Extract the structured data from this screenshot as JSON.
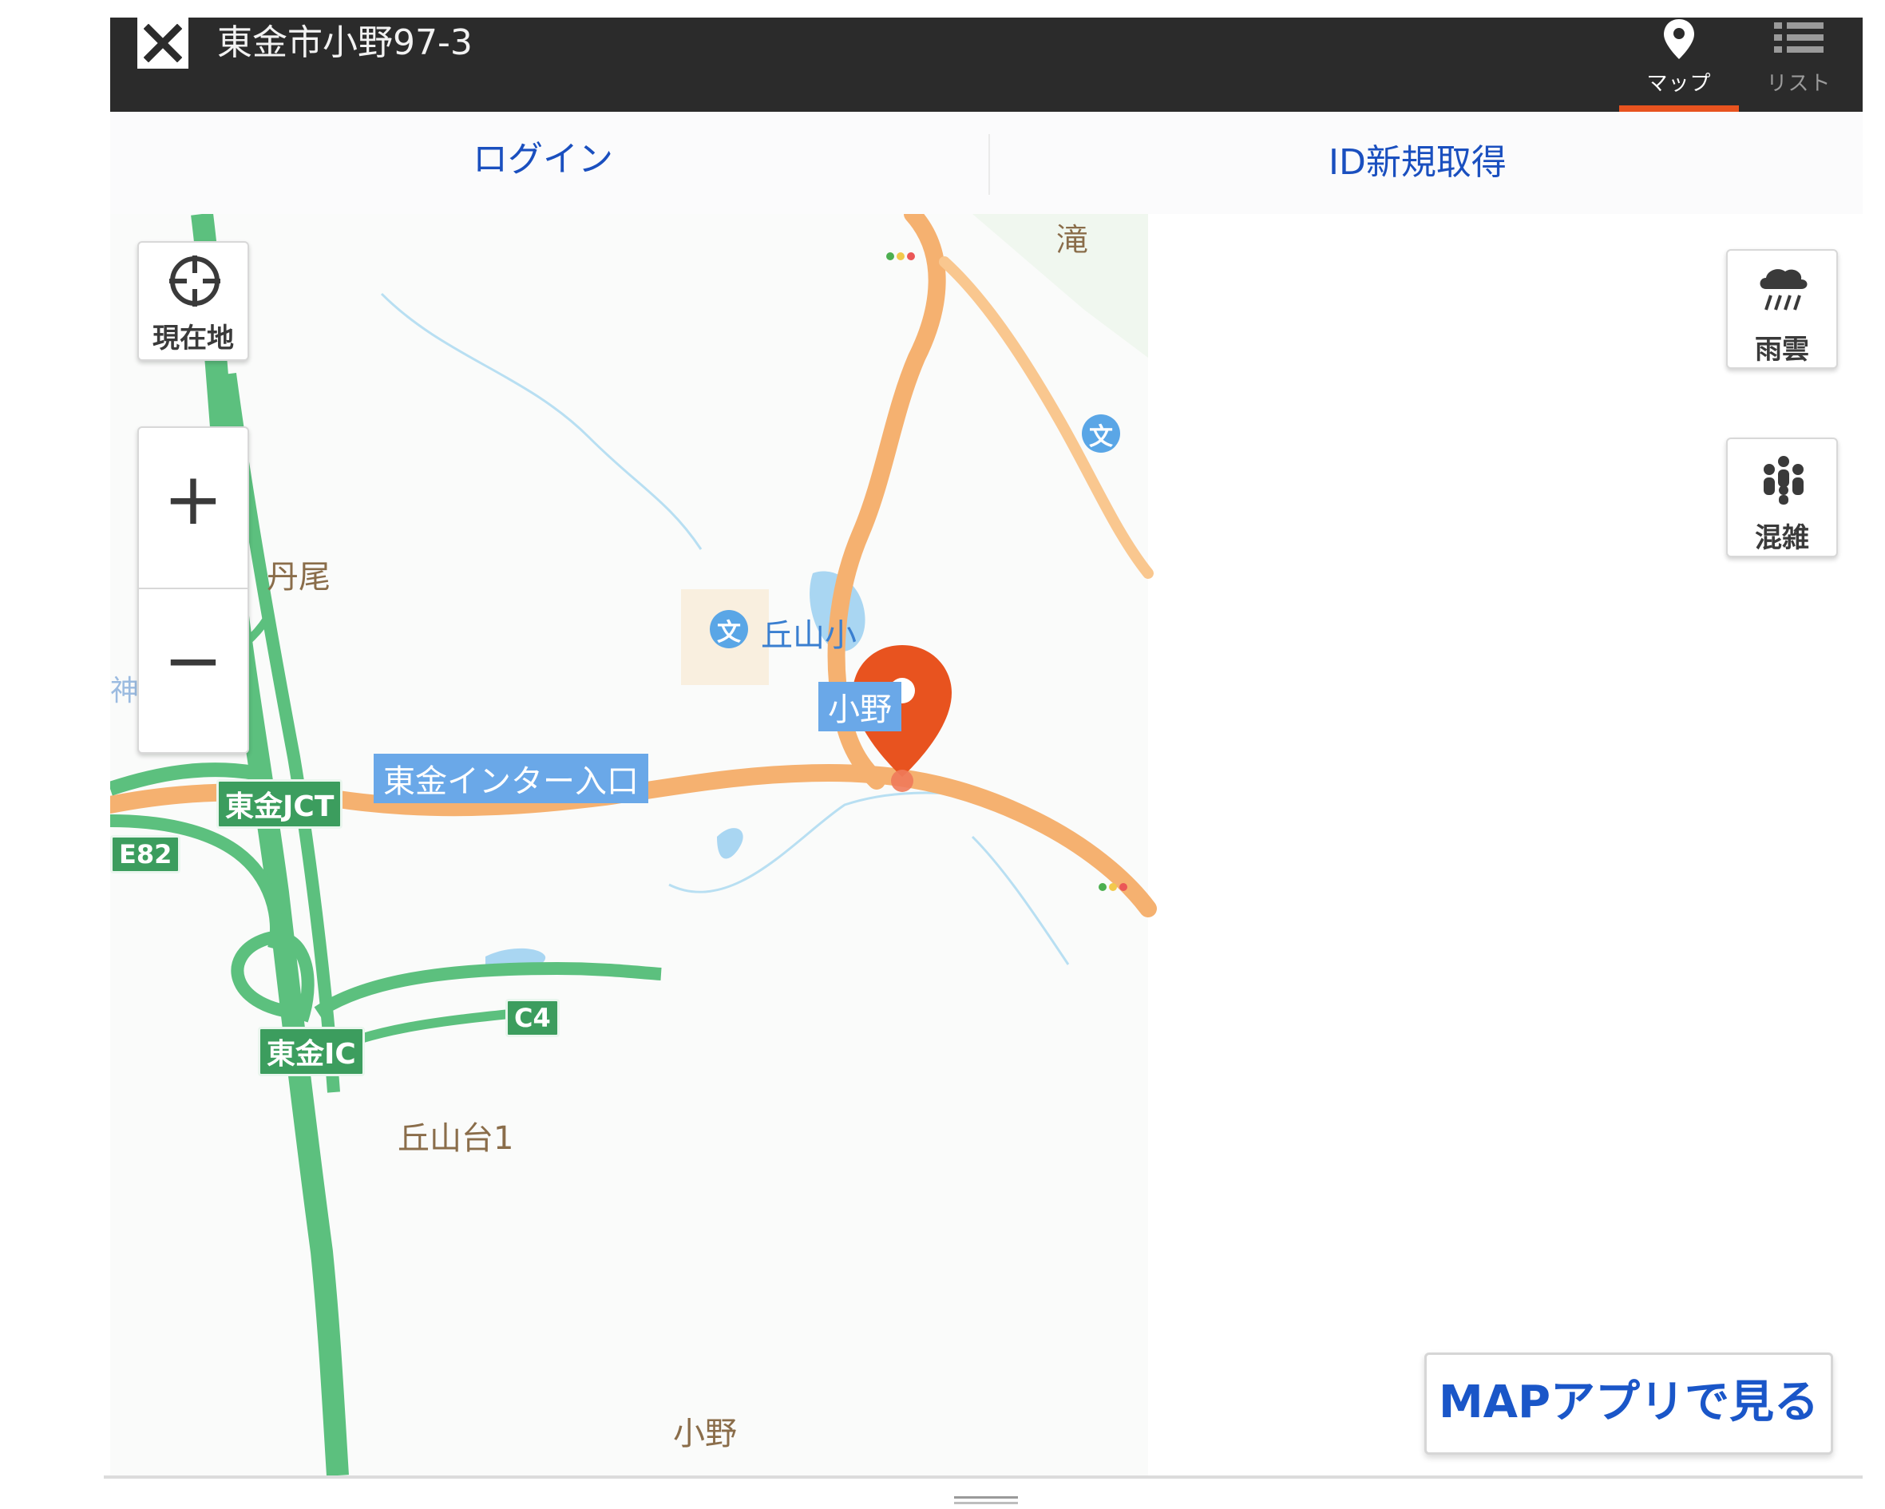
{
  "header": {
    "title": "東金市小野97-3",
    "tabs": [
      {
        "label": "マップ",
        "active": true
      },
      {
        "label": "リスト",
        "active": false
      }
    ],
    "accent_color": "#e8531f"
  },
  "auth": {
    "login_label": "ログイン",
    "signup_label": "ID新規取得",
    "link_color": "#1a4fbf"
  },
  "map_controls": {
    "current_location_label": "現在地",
    "zoom_in_label": "+",
    "zoom_out_label": "−",
    "rain_label": "雨雲",
    "crowd_label": "混雑"
  },
  "map_labels": {
    "tanbi": "丹尾",
    "taki": "滝",
    "okayama_school": "丘山小",
    "ono_station": "小野",
    "togane_interchange_entrance": "東金インター入口",
    "togane_jct": "東金JCT",
    "e82": "E82",
    "c4": "C4",
    "togane_ic": "東金IC",
    "okayamadai": "丘山台1",
    "ono_bottom": "小野",
    "shrine_partial": "神社"
  },
  "map_colors": {
    "expressway": "#5cc07e",
    "main_road": "#f5b170",
    "water": "#a9d6f2",
    "pin": "#e8531f"
  },
  "app_button_label": "MAPアプリで見る"
}
